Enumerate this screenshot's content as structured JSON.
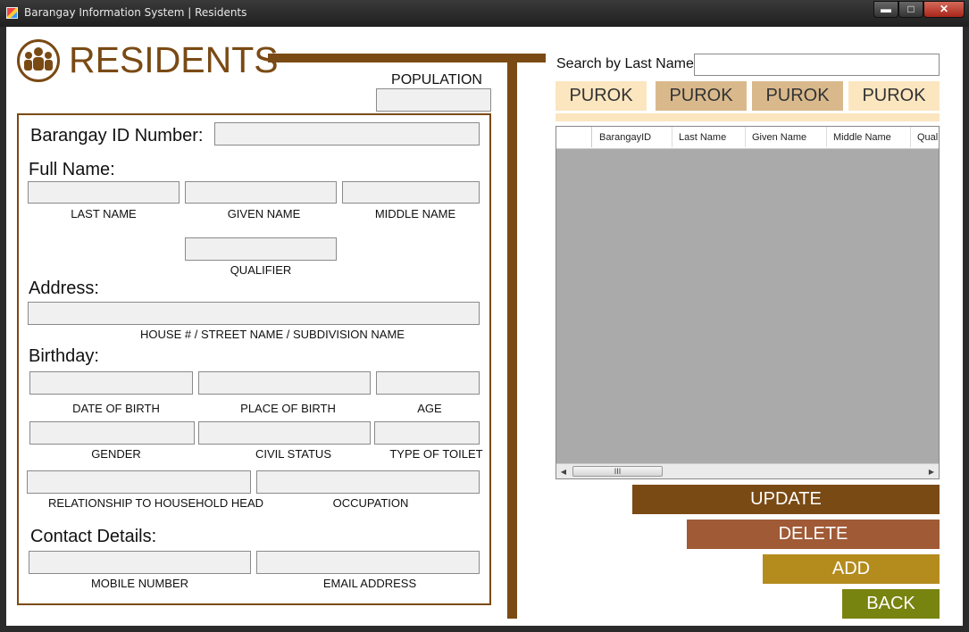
{
  "window": {
    "title": "Barangay Information System | Residents",
    "controls": {
      "minimize": "▬",
      "maximize": "□",
      "close": "✕"
    }
  },
  "header": {
    "title": "RESIDENTS",
    "population_label": "POPULATION",
    "population_value": ""
  },
  "form": {
    "barangay_id_label": "Barangay ID Number:",
    "barangay_id_value": "",
    "full_name_label": "Full Name:",
    "last_name_caption": "LAST NAME",
    "given_name_caption": "GIVEN NAME",
    "middle_name_caption": "MIDDLE NAME",
    "qualifier_caption": "QUALIFIER",
    "address_label": "Address:",
    "address_caption": "HOUSE # / STREET NAME / SUBDIVISION NAME",
    "birthday_label": "Birthday:",
    "date_of_birth_caption": "DATE OF BIRTH",
    "place_of_birth_caption": "PLACE OF BIRTH",
    "age_caption": "AGE",
    "gender_caption": "GENDER",
    "civil_status_caption": "CIVIL STATUS",
    "toilet_caption": "TYPE OF TOILET",
    "relationship_caption": "RELATIONSHIP TO HOUSEHOLD HEAD",
    "occupation_caption": "OCCUPATION",
    "contact_label": "Contact Details:",
    "mobile_caption": "MOBILE NUMBER",
    "email_caption": "EMAIL ADDRESS"
  },
  "search": {
    "label": "Search by Last Name:",
    "value": ""
  },
  "purok_tabs": [
    {
      "label": "PUROK",
      "color": "#fbe6c0"
    },
    {
      "label": "PUROK",
      "color": "#d9b98c"
    },
    {
      "label": "PUROK",
      "color": "#d9b98c"
    },
    {
      "label": "PUROK",
      "color": "#fbe6c0"
    }
  ],
  "grid": {
    "columns": [
      "BarangayID",
      "Last Name",
      "Given Name",
      "Middle Name",
      "Quali"
    ],
    "rows": [],
    "scroll_thumb": "III"
  },
  "actions": {
    "update": {
      "label": "UPDATE",
      "color": "#7a4a14"
    },
    "delete": {
      "label": "DELETE",
      "color": "#a05a36"
    },
    "add": {
      "label": "ADD",
      "color": "#b48c1e"
    },
    "back": {
      "label": "BACK",
      "color": "#788410"
    }
  },
  "colors": {
    "brand_brown": "#7a4a14",
    "grid_background": "#aaaaaa"
  }
}
